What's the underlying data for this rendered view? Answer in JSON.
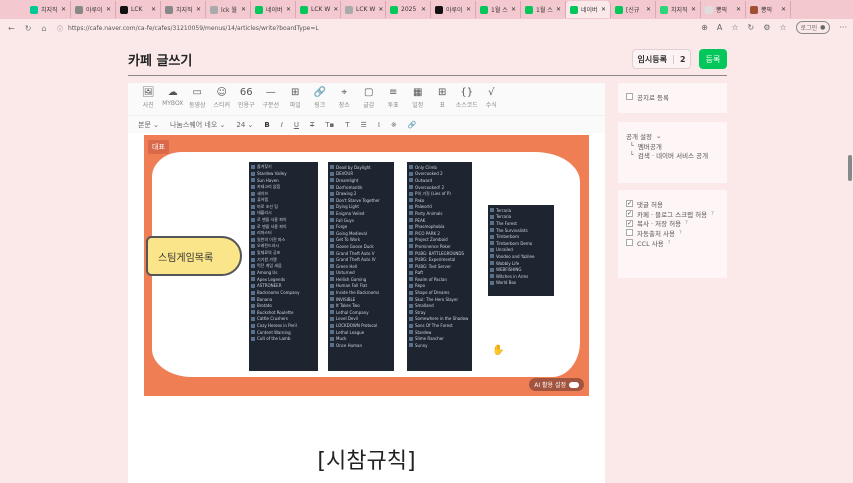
{
  "browser": {
    "tabs": [
      {
        "label": "치지직",
        "color": "#00c896"
      },
      {
        "label": "아루이",
        "color": "#888"
      },
      {
        "label": "LCK",
        "color": "#111"
      },
      {
        "label": "치지직",
        "color": "#888"
      },
      {
        "label": "lck 월",
        "color": "#aaa"
      },
      {
        "label": "네이버",
        "color": "#03c75a"
      },
      {
        "label": "LCK W",
        "color": "#03c75a"
      },
      {
        "label": "LCK W",
        "color": "#aaa"
      },
      {
        "label": "2025",
        "color": "#03c75a"
      },
      {
        "label": "아루이",
        "color": "#111"
      },
      {
        "label": "1월 스",
        "color": "#03c75a"
      },
      {
        "label": "1월 스",
        "color": "#03c75a"
      },
      {
        "label": "네이버",
        "color": "#03c75a",
        "active": true
      },
      {
        "label": "[신규",
        "color": "#03c75a"
      },
      {
        "label": "치지직",
        "color": "#2bd67b"
      },
      {
        "label": "뽕픽",
        "color": "#ddd"
      },
      {
        "label": "뽕픽",
        "color": "#a05030"
      }
    ],
    "url": "https://cafe.naver.com/ca-fe/cafes/31210059/menus/14/articles/write?boardType=L",
    "login_label": "로그인"
  },
  "page": {
    "title": "카페 글쓰기",
    "temp_save_label": "임시등록",
    "temp_save_count": "2",
    "submit_label": "등록"
  },
  "toolbar": {
    "items": [
      {
        "icon": "🖼",
        "label": "사진"
      },
      {
        "icon": "☁",
        "label": "MYBOX"
      },
      {
        "icon": "▭",
        "label": "동영상"
      },
      {
        "icon": "☺",
        "label": "스티커"
      },
      {
        "icon": "66",
        "label": "인용구"
      },
      {
        "icon": "—",
        "label": "구분선"
      },
      {
        "icon": "⊞",
        "label": "파일"
      },
      {
        "icon": "🔗",
        "label": "링크"
      },
      {
        "icon": "⌖",
        "label": "장소"
      },
      {
        "icon": "▢",
        "label": "글감"
      },
      {
        "icon": "≡",
        "label": "투표"
      },
      {
        "icon": "▦",
        "label": "일정"
      },
      {
        "icon": "⊞",
        "label": "표"
      },
      {
        "icon": "{}",
        "label": "소스코드"
      },
      {
        "icon": "√",
        "label": "수식"
      }
    ]
  },
  "format": {
    "style": "본문",
    "font": "나눔스퀘어 네오",
    "size": "24",
    "bold": "B",
    "italic": "I",
    "underline": "U",
    "strike": "T",
    "color": "T▪",
    "bg": "T",
    "align": "☰",
    "line": "I",
    "special": "※",
    "link": "🔗"
  },
  "image": {
    "badge": "대표",
    "bubble": "스팀게임목록",
    "ai_label": "AI 활용 설정",
    "columns": [
      [
        "즐겨찾기",
        "Stardew Valley",
        "Sun Haven",
        "카테고리 없음",
        "세이브",
        "퓨어랩",
        "미로 조선 팅",
        "데블리시",
        "로 맨을 사용 파이",
        "로 맨을 사용 파이",
        "리마스터",
        "일반의 이전 파스",
        "오래된드라시",
        "맞재료의 공포",
        "기기원 가맹",
        "먹던 게임 세움",
        "Among Us",
        "Apex Legends",
        "ASTRONEER",
        "Backrooms Company",
        "Banana",
        "Brotato",
        "Buckshot Roulette",
        "Cattle Crushers",
        "Cozy Heroes in Peril",
        "Content Warning",
        "Cult of the Lamb"
      ],
      [
        "Dead by Daylight",
        "DEVOUR",
        "Dreamlight",
        "Dorfromantik",
        "Drawing 2",
        "Don't Starve Together",
        "Dying Light",
        "Enigma Veiled",
        "Fall Guys",
        "Forge",
        "Going Medieval",
        "Get To Work",
        "Goose Goose Duck",
        "Grand Theft Auto V",
        "Grand Theft Auto IV",
        "Green Hell",
        "Unturned",
        "Hellish Gaming",
        "Human Fall Flat",
        "Inside the Backrooms",
        "INVISIBLE",
        "It Takes Two",
        "Lethal Company",
        "Level Devil",
        "LOCKDOWN Protocol",
        "Lethal League",
        "Muck",
        "Once Human"
      ],
      [
        "Only Climb",
        "Overcooked 2",
        "Outward",
        "Overcooked! 2",
        "P의 거짓 (Lies of P)",
        "Pako",
        "Palworld",
        "Party Animals",
        "PEAK",
        "Phasmophobia",
        "PICO PARK 2",
        "Project Zomboid",
        "Prominence Poker",
        "PUBG: BATTLEGROUNDS",
        "PUBG: Experimental",
        "PUBG: Test Server",
        "Raft",
        "Realm of Paclan",
        "Repo",
        "Shape of Dreams",
        "Skul: The Hero Slayer",
        "Smalland",
        "Stray",
        "Somewhere in the Shadow",
        "Sons Of The Forest",
        "Stardew",
        "Slime Rancher",
        "Sunny"
      ],
      [
        "Terraria",
        "Terraria",
        "The Forest",
        "The Survivalists",
        "Timberborn",
        "Timberborn Demo",
        "Unrailed",
        "Voodoo and Yazilee",
        "Wobbly Life",
        "WEBFISHING",
        "Witches in Arms",
        "World Box"
      ]
    ]
  },
  "content": {
    "heading": "[시참규칙]"
  },
  "sidebar": {
    "notice": {
      "label": "공지로 등록",
      "checked": false
    },
    "visibility": {
      "title": "공개 설정",
      "items": [
        "멤버공개",
        "검색 · 네이버 서비스 공개"
      ]
    },
    "options": [
      {
        "label": "댓글 허용",
        "checked": true,
        "help": false
      },
      {
        "label": "카페 · 블로그 스크랩 허용",
        "checked": true,
        "help": true
      },
      {
        "label": "복사 · 저장 허용",
        "checked": true,
        "help": true
      },
      {
        "label": "자동출처 사용",
        "checked": false,
        "help": true
      },
      {
        "label": "CCL 사용",
        "checked": false,
        "help": true
      }
    ]
  }
}
